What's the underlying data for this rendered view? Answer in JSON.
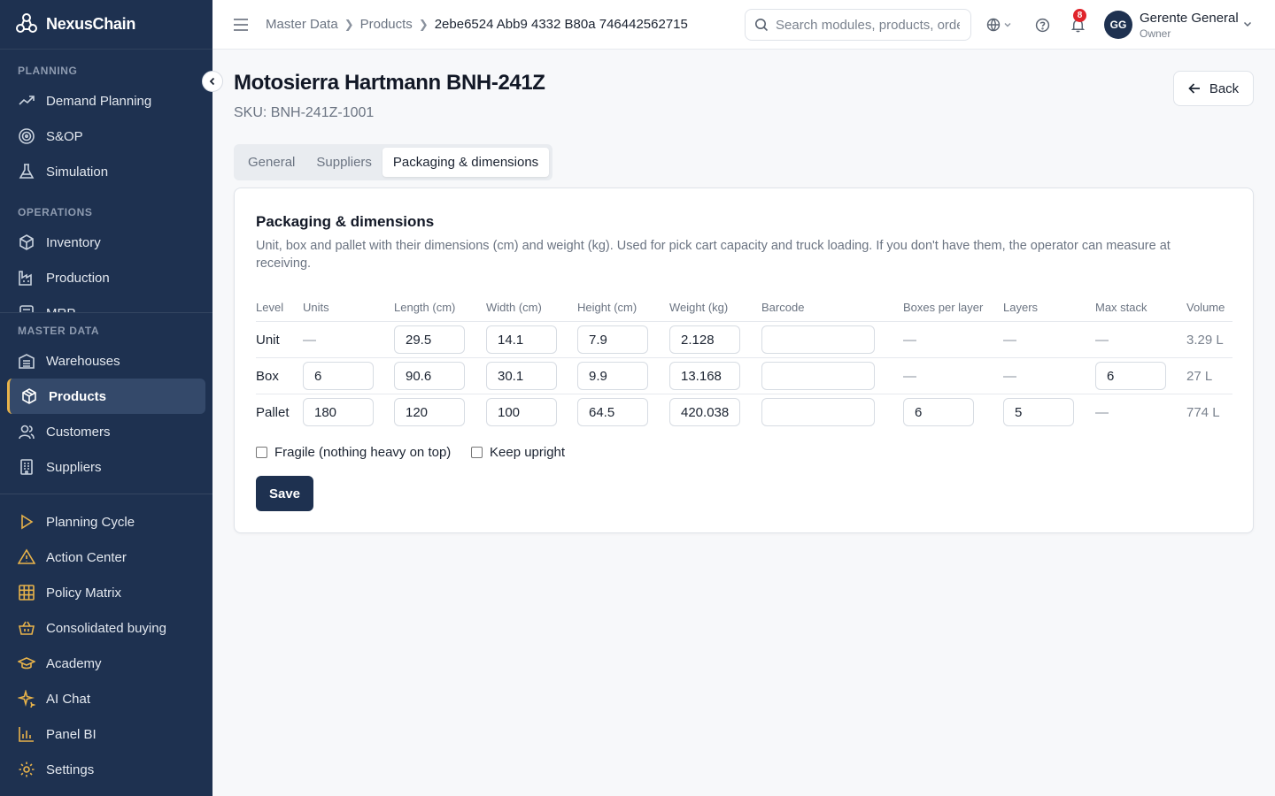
{
  "brand": {
    "name": "NexusChain"
  },
  "sidebar": {
    "sections": {
      "planning": "PLANNING",
      "operations": "OPERATIONS",
      "master_data": "MASTER DATA"
    },
    "planning_items": [
      {
        "label": "Demand Planning",
        "icon": "trending-up-icon"
      },
      {
        "label": "S&OP",
        "icon": "target-icon"
      },
      {
        "label": "Simulation",
        "icon": "flask-icon"
      }
    ],
    "operations_items": [
      {
        "label": "Inventory",
        "icon": "box-icon"
      },
      {
        "label": "Production",
        "icon": "factory-icon"
      },
      {
        "label": "MRP",
        "icon": "calculator-icon"
      }
    ],
    "master_items": [
      {
        "label": "Warehouses",
        "icon": "warehouse-icon"
      },
      {
        "label": "Products",
        "icon": "package-icon",
        "active": true
      },
      {
        "label": "Customers",
        "icon": "users-icon"
      },
      {
        "label": "Suppliers",
        "icon": "building-icon"
      }
    ],
    "bottom_items": [
      {
        "label": "Planning Cycle",
        "icon": "play-icon"
      },
      {
        "label": "Action Center",
        "icon": "alert-triangle-icon"
      },
      {
        "label": "Policy Matrix",
        "icon": "grid-icon"
      },
      {
        "label": "Consolidated buying",
        "icon": "basket-icon"
      },
      {
        "label": "Academy",
        "icon": "graduation-cap-icon"
      },
      {
        "label": "AI Chat",
        "icon": "sparkles-icon"
      },
      {
        "label": "Panel BI",
        "icon": "bar-chart-icon"
      },
      {
        "label": "Settings",
        "icon": "gear-icon"
      }
    ]
  },
  "topbar": {
    "breadcrumb": [
      "Master Data",
      "Products",
      "2ebe6524 Abb9 4332 B80a 746442562715"
    ],
    "search_placeholder": "Search modules, products, orders...",
    "notifications_count": "8",
    "user": {
      "initials": "GG",
      "name": "Gerente General",
      "role": "Owner"
    }
  },
  "page": {
    "title": "Motosierra Hartmann BNH-241Z",
    "sku": "SKU: BNH-241Z-1001",
    "back_label": "Back",
    "tabs": [
      "General",
      "Suppliers",
      "Packaging & dimensions"
    ],
    "active_tab": "Packaging & dimensions"
  },
  "packaging": {
    "title": "Packaging & dimensions",
    "description": "Unit, box and pallet with their dimensions (cm) and weight (kg). Used for pick cart capacity and truck loading. If you don't have them, the operator can measure at receiving.",
    "columns": [
      "Level",
      "Units",
      "Length (cm)",
      "Width (cm)",
      "Height (cm)",
      "Weight (kg)",
      "Barcode",
      "Boxes per layer",
      "Layers",
      "Max stack",
      "Volume"
    ],
    "rows": [
      {
        "level": "Unit",
        "units": "—",
        "length": "29.5",
        "width": "14.1",
        "height": "7.9",
        "weight": "2.128",
        "barcode": "",
        "boxes_per_layer": "—",
        "layers": "—",
        "max_stack": "—",
        "volume": "3.29 L"
      },
      {
        "level": "Box",
        "units": "6",
        "length": "90.6",
        "width": "30.1",
        "height": "9.9",
        "weight": "13.168",
        "barcode": "",
        "boxes_per_layer": "—",
        "layers": "—",
        "max_stack": "6",
        "volume": "27 L"
      },
      {
        "level": "Pallet",
        "units": "180",
        "length": "120",
        "width": "100",
        "height": "64.5",
        "weight": "420.038",
        "barcode": "",
        "boxes_per_layer": "6",
        "layers": "5",
        "max_stack": "—",
        "volume": "774 L"
      }
    ],
    "checkboxes": [
      {
        "label": "Fragile (nothing heavy on top)",
        "checked": false
      },
      {
        "label": "Keep upright",
        "checked": false
      }
    ],
    "save_label": "Save"
  },
  "colors": {
    "sidebar_bg": "#1e3150",
    "accent": "#e8b34a",
    "primary_button": "#1e3150",
    "badge": "#e0242b"
  }
}
